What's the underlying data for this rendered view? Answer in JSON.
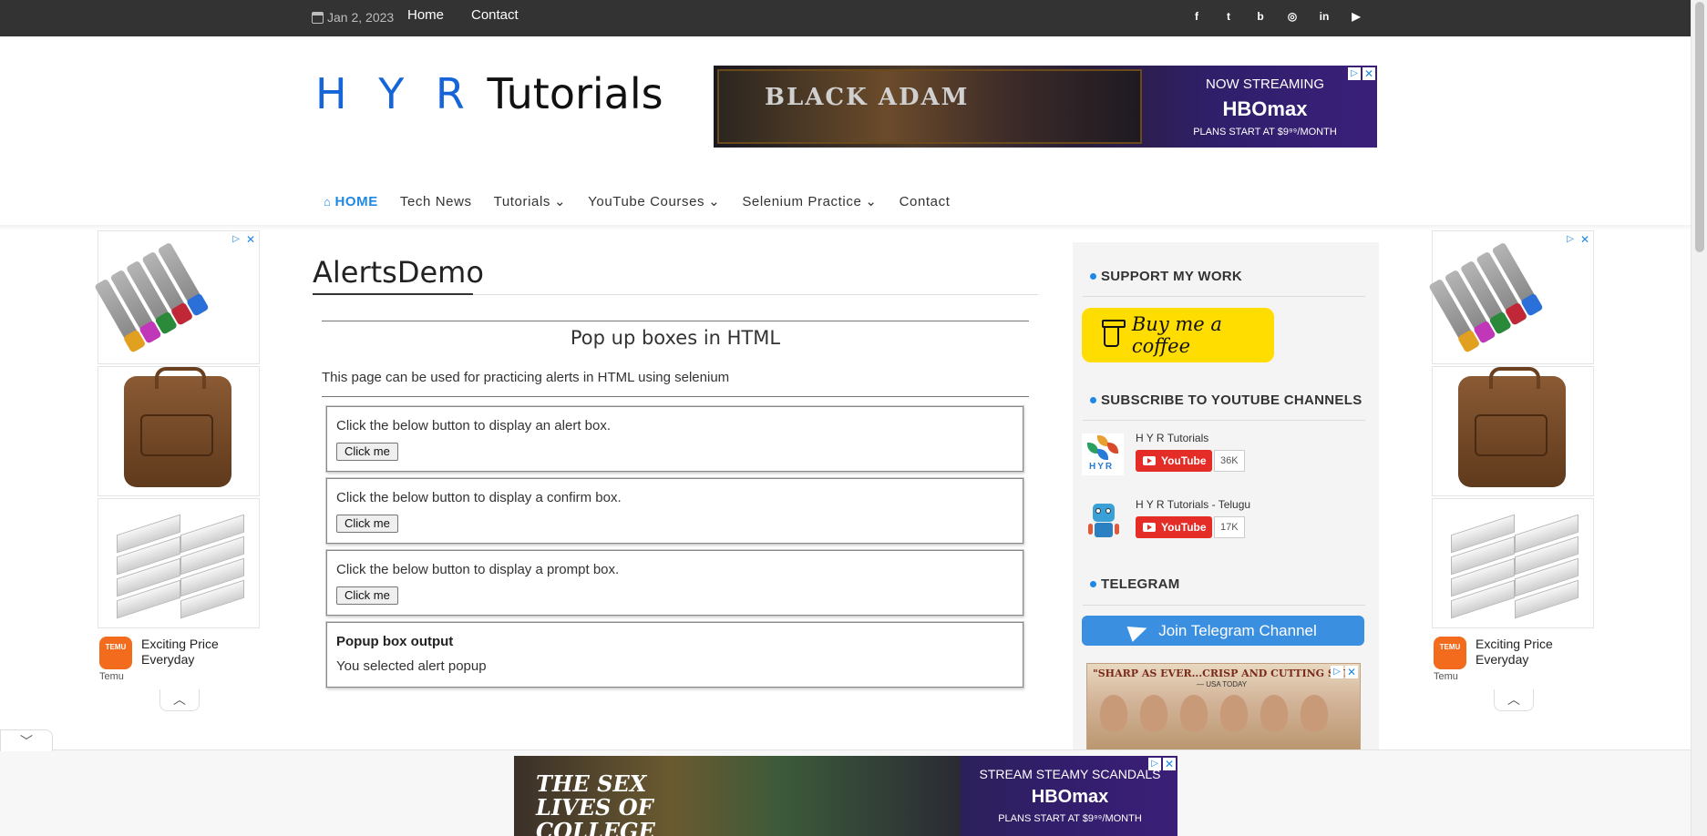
{
  "topbar": {
    "date": "Jan 2, 2023",
    "links": [
      "Home",
      "Contact"
    ],
    "social_icons": [
      "facebook-icon",
      "twitter-icon",
      "blogger-icon",
      "instagram-icon",
      "linkedin-icon",
      "youtube-icon"
    ],
    "social_glyphs": [
      "f",
      "t",
      "b",
      "◎",
      "in",
      "▶"
    ]
  },
  "logo": {
    "part1": "H Y R",
    "part2": " Tutorials"
  },
  "ad_top": {
    "left_text": "BLACK ADAM",
    "line1": "NOW STREAMING",
    "line2": "HBOmax",
    "line3": "PLANS START AT $9⁹⁹/MONTH"
  },
  "nav": {
    "items": [
      {
        "label": "HOME",
        "active": true
      },
      {
        "label": "Tech News",
        "active": false
      },
      {
        "label": "Tutorials",
        "active": false,
        "dropdown": true
      },
      {
        "label": "YouTube Courses",
        "active": false,
        "dropdown": true
      },
      {
        "label": "Selenium Practice",
        "active": false,
        "dropdown": true
      },
      {
        "label": "Contact",
        "active": false
      }
    ]
  },
  "side_ads": {
    "caption": "Exciting Price Everyday",
    "brand": "Temu",
    "logo_text": "TEMU"
  },
  "main": {
    "title": "AlertsDemo",
    "subtitle": "Pop up boxes in HTML",
    "intro": "This page can be used for practicing alerts in HTML using selenium",
    "boxes": [
      {
        "text": "Click the below button to display an alert box.",
        "button": "Click me"
      },
      {
        "text": "Click the below button to display a confirm box.",
        "button": "Click me"
      },
      {
        "text": "Click the below button to display a prompt box.",
        "button": "Click me"
      }
    ],
    "output": {
      "heading": "Popup box output",
      "value": "You selected alert popup"
    }
  },
  "sidebar": {
    "support_title": "SUPPORT MY WORK",
    "coffee_label": "Buy me a coffee",
    "subscribe_title": "SUBSCRIBE TO YOUTUBE CHANNELS",
    "channels": [
      {
        "name": "H Y R Tutorials",
        "button": "YouTube",
        "count": "36K"
      },
      {
        "name": "H Y R Tutorials - Telugu",
        "button": "YouTube",
        "count": "17K"
      }
    ],
    "telegram_title": "TELEGRAM",
    "telegram_button": "Join Telegram Channel",
    "ad_quote": "\"SHARP AS EVER...CRISP AND CUTTING SAT",
    "ad_source": "— USA TODAY"
  },
  "ad_bottom": {
    "left_text": "THE SEX LIVES OF COLLEGE GIRLS",
    "line1": "STREAM STEAMY SCANDALS",
    "line2": "HBOmax",
    "line3": "PLANS START AT $9⁹⁹/MONTH"
  },
  "colors": {
    "accent": "#1e88e5",
    "topbar": "#333333",
    "logo_blue": "#1565d8"
  }
}
